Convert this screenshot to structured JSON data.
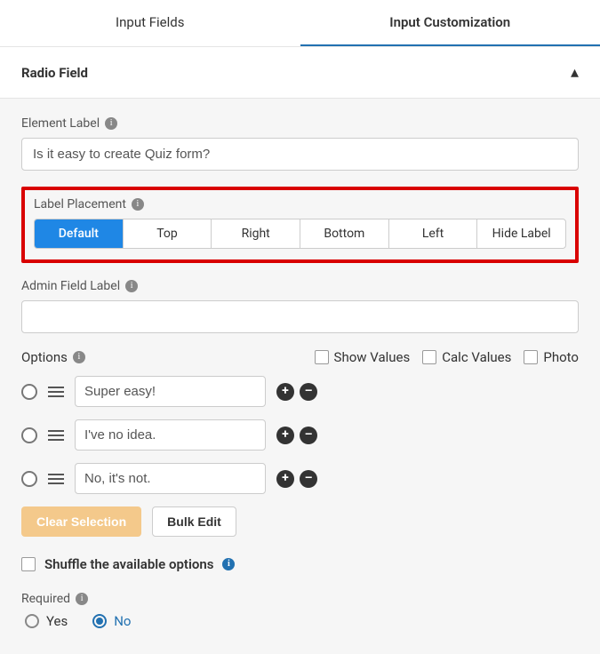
{
  "tabs": {
    "items": [
      "Input Fields",
      "Input Customization"
    ],
    "active": 1
  },
  "accordion_title": "Radio Field",
  "element_label": {
    "label": "Element Label",
    "value": "Is it easy to create Quiz form?"
  },
  "label_placement": {
    "label": "Label Placement",
    "options": [
      "Default",
      "Top",
      "Right",
      "Bottom",
      "Left",
      "Hide Label"
    ],
    "active": 0
  },
  "admin_label": {
    "label": "Admin Field Label",
    "value": ""
  },
  "options": {
    "label": "Options",
    "toggles": [
      "Show Values",
      "Calc Values",
      "Photo"
    ],
    "items": [
      "Super easy!",
      "I've no idea.",
      "No, it's not."
    ]
  },
  "buttons": {
    "clear": "Clear Selection",
    "bulk": "Bulk Edit"
  },
  "shuffle": {
    "label": "Shuffle the available options"
  },
  "required": {
    "label": "Required",
    "options": [
      "Yes",
      "No"
    ],
    "active": 1
  }
}
